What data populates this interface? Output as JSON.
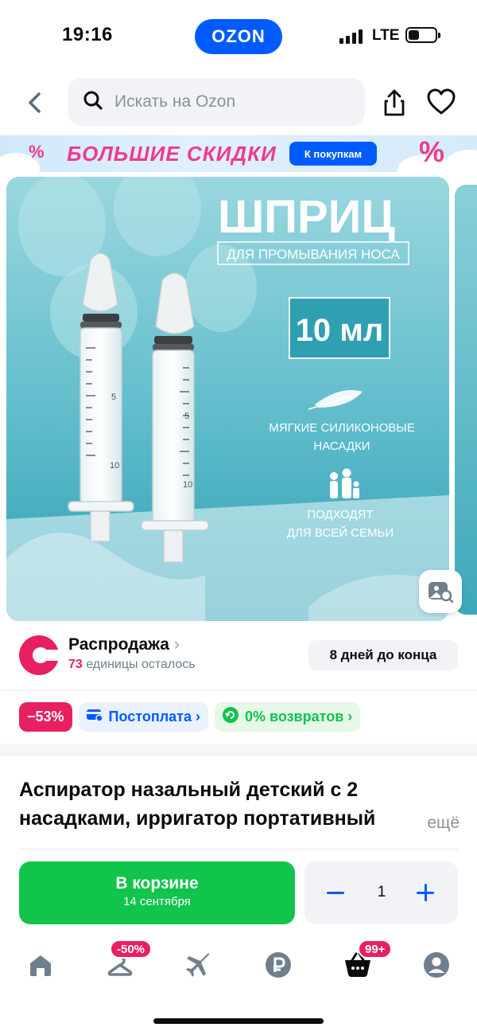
{
  "status_bar": {
    "time": "19:16",
    "app_pill": "OZON",
    "network": "LTE"
  },
  "search": {
    "placeholder": "Искать на Ozon"
  },
  "banner": {
    "headline": "БОЛЬШИЕ СКИДКИ",
    "button": "К покупкам",
    "percent_sign": "%"
  },
  "product_image": {
    "title": "ШПРИЦ",
    "subtitle": "ДЛЯ ПРОМЫВАНИЯ НОСА",
    "volume": "10 мл",
    "feature1": [
      "МЯГКИЕ СИЛИКОНОВЫЕ",
      "НАСАДКИ"
    ],
    "feature2": [
      "ПОДХОДЯТ",
      "ДЛЯ ВСЕЙ СЕМЬИ"
    ],
    "scale_marks": [
      "5",
      "10"
    ]
  },
  "sale": {
    "title": "Распродажа",
    "chevron": "›",
    "count": "73",
    "remaining_text": " единицы осталось",
    "days_left": "8 дней до конца"
  },
  "badges": {
    "discount": "−53%",
    "postpay": "Постоплата",
    "returns": "0% возвратов",
    "chevron": "›"
  },
  "product": {
    "title": "Аспиратор назальный детский с 2 насадками, ирригатор портативный",
    "more": "ещё"
  },
  "cart": {
    "label": "В корзине",
    "date": "14 сентября",
    "quantity": "1"
  },
  "bottom_nav": {
    "catalog_badge": "-50%",
    "cart_badge": "99+"
  },
  "colors": {
    "ozon_blue": "#005bff",
    "green": "#10c44c",
    "pink": "#e8205f"
  }
}
